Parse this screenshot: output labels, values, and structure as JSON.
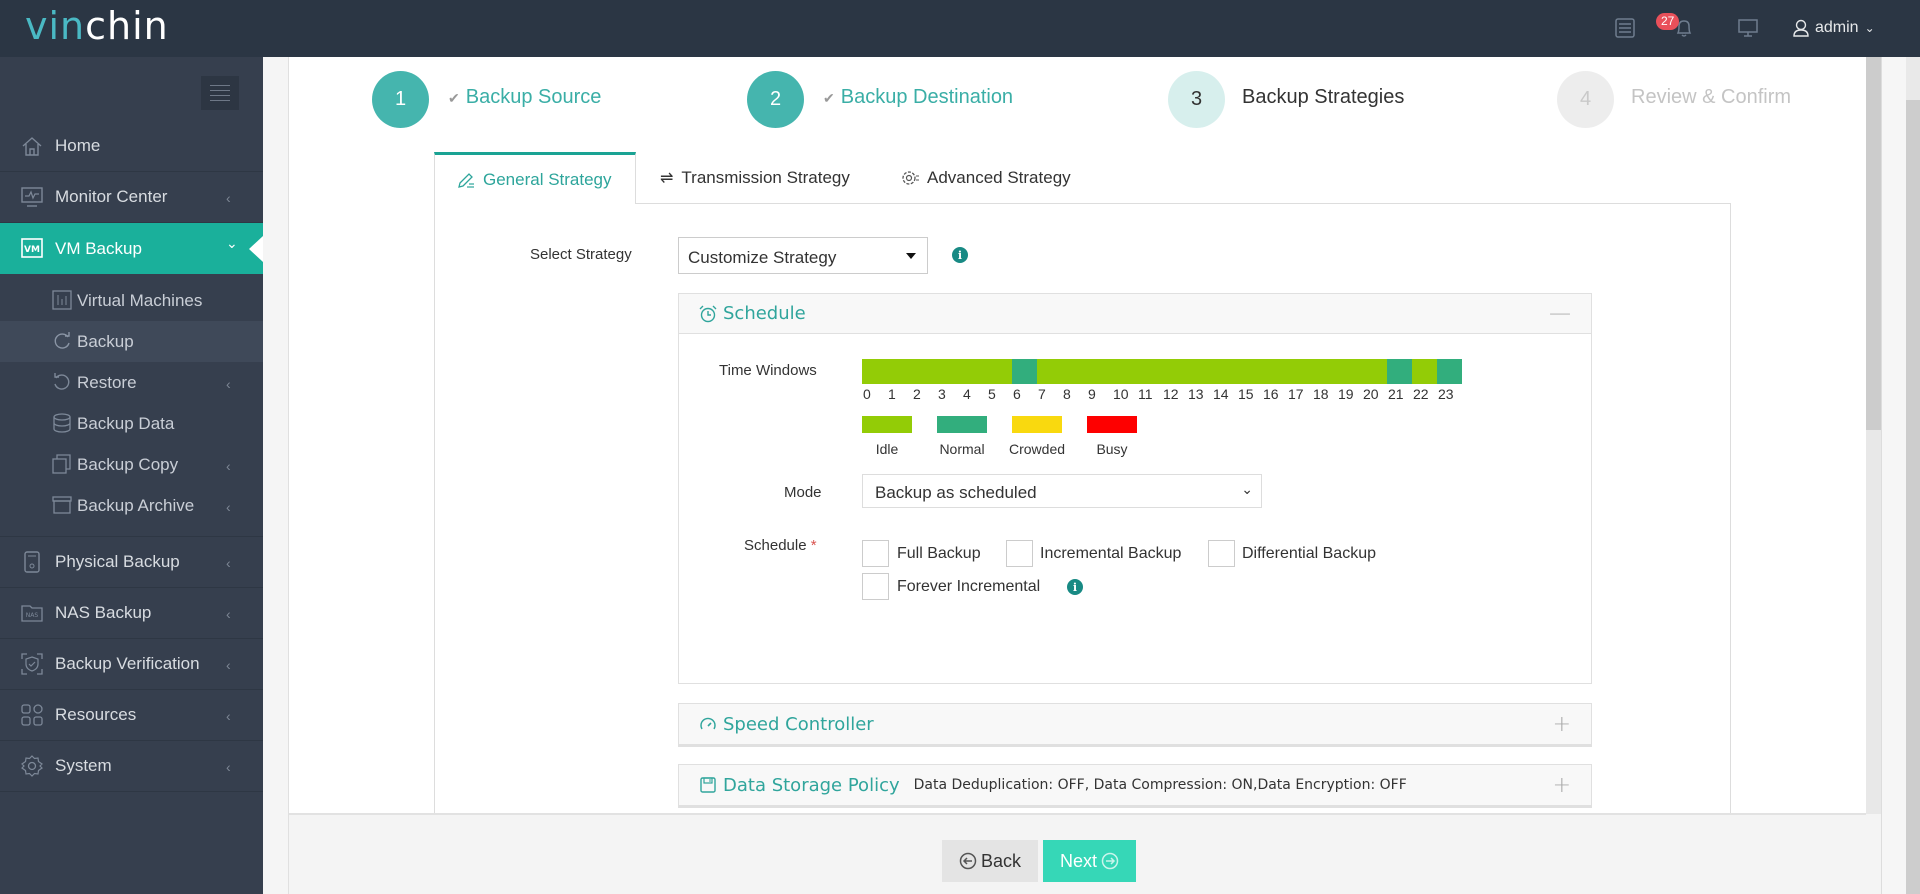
{
  "app": {
    "logo_part1": "vin",
    "logo_part2": "chin",
    "notifications_count": "27",
    "user": "admin"
  },
  "sidebar": {
    "items": [
      {
        "label": "Home",
        "icon": "home-icon",
        "has_chevron": false
      },
      {
        "label": "Monitor Center",
        "icon": "monitor-icon",
        "has_chevron": true
      },
      {
        "label": "VM Backup",
        "icon": "vm-icon",
        "active": true,
        "expanded": true
      },
      {
        "label": "Physical Backup",
        "icon": "physical-server-icon",
        "has_chevron": true
      },
      {
        "label": "NAS Backup",
        "icon": "nas-icon",
        "has_chevron": true
      },
      {
        "label": "Backup Verification",
        "icon": "shield-check-icon",
        "has_chevron": true
      },
      {
        "label": "Resources",
        "icon": "grid-icon",
        "has_chevron": true
      },
      {
        "label": "System",
        "icon": "gear-icon",
        "has_chevron": true
      }
    ],
    "vm_backup_subitems": [
      {
        "label": "Virtual Machines",
        "icon": "chart-icon",
        "has_chevron": false
      },
      {
        "label": "Backup",
        "icon": "refresh-icon",
        "has_chevron": false,
        "current": true
      },
      {
        "label": "Restore",
        "icon": "undo-icon",
        "has_chevron": true
      },
      {
        "label": "Backup Data",
        "icon": "database-icon",
        "has_chevron": false
      },
      {
        "label": "Backup Copy",
        "icon": "copy-icon",
        "has_chevron": true
      },
      {
        "label": "Backup Archive",
        "icon": "archive-icon",
        "has_chevron": true
      }
    ]
  },
  "wizard": {
    "steps": [
      {
        "number": "1",
        "label": "Backup Source",
        "state": "done"
      },
      {
        "number": "2",
        "label": "Backup Destination",
        "state": "done"
      },
      {
        "number": "3",
        "label": "Backup Strategies",
        "state": "current"
      },
      {
        "number": "4",
        "label": "Review & Confirm",
        "state": "todo"
      }
    ],
    "tabs": [
      {
        "label": "General Strategy",
        "icon": "edit-icon",
        "active": true
      },
      {
        "label": "Transmission Strategy",
        "icon": "transfer-icon",
        "active": false
      },
      {
        "label": "Advanced Strategy",
        "icon": "settings-icon",
        "active": false
      }
    ]
  },
  "strategy": {
    "select_label": "Select Strategy",
    "select_value": "Customize Strategy"
  },
  "schedule_panel": {
    "title": "Schedule",
    "toggle": "—",
    "time_windows_label": "Time Windows",
    "hours": [
      "0",
      "1",
      "2",
      "3",
      "4",
      "5",
      "6",
      "7",
      "8",
      "9",
      "10",
      "11",
      "12",
      "13",
      "14",
      "15",
      "16",
      "17",
      "18",
      "19",
      "20",
      "21",
      "22",
      "23"
    ],
    "hour_states": [
      "idle",
      "idle",
      "idle",
      "idle",
      "idle",
      "idle",
      "normal",
      "idle",
      "idle",
      "idle",
      "idle",
      "idle",
      "idle",
      "idle",
      "idle",
      "idle",
      "idle",
      "idle",
      "idle",
      "idle",
      "idle",
      "normal",
      "idle",
      "normal"
    ],
    "legend": [
      {
        "key": "idle",
        "label": "Idle",
        "color": "#93cc06"
      },
      {
        "key": "normal",
        "label": "Normal",
        "color": "#32ae7d"
      },
      {
        "key": "crowded",
        "label": "Crowded",
        "color": "#f9d90f"
      },
      {
        "key": "busy",
        "label": "Busy",
        "color": "#fe0000"
      }
    ],
    "mode_label": "Mode",
    "mode_value": "Backup as scheduled",
    "schedule_label": "Schedule",
    "required_mark": "*",
    "options": [
      {
        "label": "Full Backup",
        "checked": false
      },
      {
        "label": "Incremental Backup",
        "checked": false
      },
      {
        "label": "Differential Backup",
        "checked": false
      },
      {
        "label": "Forever Incremental",
        "checked": false
      }
    ]
  },
  "speed_panel": {
    "title": "Speed Controller",
    "toggle": "+"
  },
  "storage_panel": {
    "title": "Data Storage Policy",
    "summary": "Data Deduplication: OFF, Data Compression: ON,Data Encryption: OFF",
    "toggle": "+"
  },
  "footer": {
    "back_label": "Back",
    "next_label": "Next"
  },
  "colors": {
    "accent": "#1ab09b",
    "header_bg": "#2b3644",
    "sidebar_bg": "#363f4e",
    "next_button": "#36d7b7",
    "badge": "#e9505a"
  }
}
